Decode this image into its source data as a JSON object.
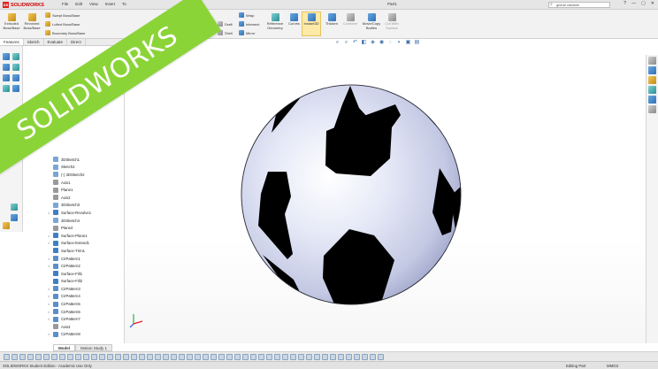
{
  "app": {
    "brand": "SOLIDWORKS",
    "brand_mark": "DS",
    "menus": [
      "File",
      "Edit",
      "View",
      "Insert",
      "To"
    ],
    "document_title": "Part1",
    "search_placeholder": "global variable",
    "window_controls": [
      "?",
      "—",
      "▢",
      "✕"
    ]
  },
  "ribbon": {
    "extruded": "Extruded Boss/Base",
    "revolved": "Revolved Boss/Base",
    "swept": "Swept Boss/Base",
    "lofted": "Lofted Boss/Base",
    "boundary": "Boundary Boss/Base",
    "draft": "Draft",
    "shell": "Shell",
    "wrap": "Wrap",
    "intersect": "Intersect",
    "mirror": "Mirror",
    "reference_geometry": "Reference Geometry",
    "curves": "Curves",
    "instant3d": "Instant3D",
    "thicken": "Thicken",
    "combine": "Combine",
    "move_copy": "Move/Copy Bodies",
    "cut_surface": "Cut With Surface"
  },
  "tabs": [
    "Features",
    "Sketch",
    "Evaluate",
    "Direct"
  ],
  "tree": {
    "items": [
      {
        "label": "3DSketch1",
        "arrow": "",
        "color": "#7aa6d6"
      },
      {
        "label": "Sketch2",
        "arrow": "",
        "color": "#7aa6d6"
      },
      {
        "label": "(-) 3DSketch2",
        "arrow": "",
        "color": "#7aa6d6"
      },
      {
        "label": "Axis1",
        "arrow": "",
        "color": "#9a9a9a"
      },
      {
        "label": "Plane1",
        "arrow": "",
        "color": "#9a9a9a"
      },
      {
        "label": "Axis2",
        "arrow": "",
        "color": "#9a9a9a"
      },
      {
        "label": "3DSketch3",
        "arrow": "",
        "color": "#7aa6d6"
      },
      {
        "label": "Surface-Revolve1",
        "arrow": ">",
        "color": "#3f7fc4"
      },
      {
        "label": "3DSketch4",
        "arrow": "",
        "color": "#7aa6d6"
      },
      {
        "label": "Plane2",
        "arrow": "",
        "color": "#9a9a9a"
      },
      {
        "label": "Surface-Plane1",
        "arrow": ">",
        "color": "#3f7fc4"
      },
      {
        "label": "Surface-Extend1",
        "arrow": ">",
        "color": "#3f7fc4"
      },
      {
        "label": "Surface-Trim1",
        "arrow": "",
        "color": "#3f7fc4"
      },
      {
        "label": "CirPattern1",
        "arrow": ">",
        "color": "#5a8fc9"
      },
      {
        "label": "CirPattern2",
        "arrow": ">",
        "color": "#5a8fc9"
      },
      {
        "label": "Surface-Fill1",
        "arrow": "",
        "color": "#3f7fc4"
      },
      {
        "label": "Surface-Fill2",
        "arrow": "",
        "color": "#3f7fc4"
      },
      {
        "label": "CirPattern3",
        "arrow": ">",
        "color": "#5a8fc9"
      },
      {
        "label": "CirPattern4",
        "arrow": ">",
        "color": "#5a8fc9"
      },
      {
        "label": "CirPattern5",
        "arrow": ">",
        "color": "#5a8fc9"
      },
      {
        "label": "CirPattern6",
        "arrow": ">",
        "color": "#5a8fc9"
      },
      {
        "label": "CirPattern7",
        "arrow": ">",
        "color": "#5a8fc9"
      },
      {
        "label": "Axis4",
        "arrow": "",
        "color": "#9a9a9a"
      },
      {
        "label": "CirPattern8",
        "arrow": ">",
        "color": "#5a8fc9"
      }
    ]
  },
  "bottom_tabs": [
    "Model",
    "Motion Study 1"
  ],
  "status": {
    "edition": "SOLIDWORKS Student Edition - Academic Use Only",
    "mode": "Editing Part",
    "units": "MMGS"
  },
  "banner": {
    "text": "SOLIDWORKS",
    "color": "#8bd437"
  },
  "colors": {
    "accent": "#3d6fa8",
    "ball_face": "#dfe3f5",
    "pentagon": "#000000"
  }
}
